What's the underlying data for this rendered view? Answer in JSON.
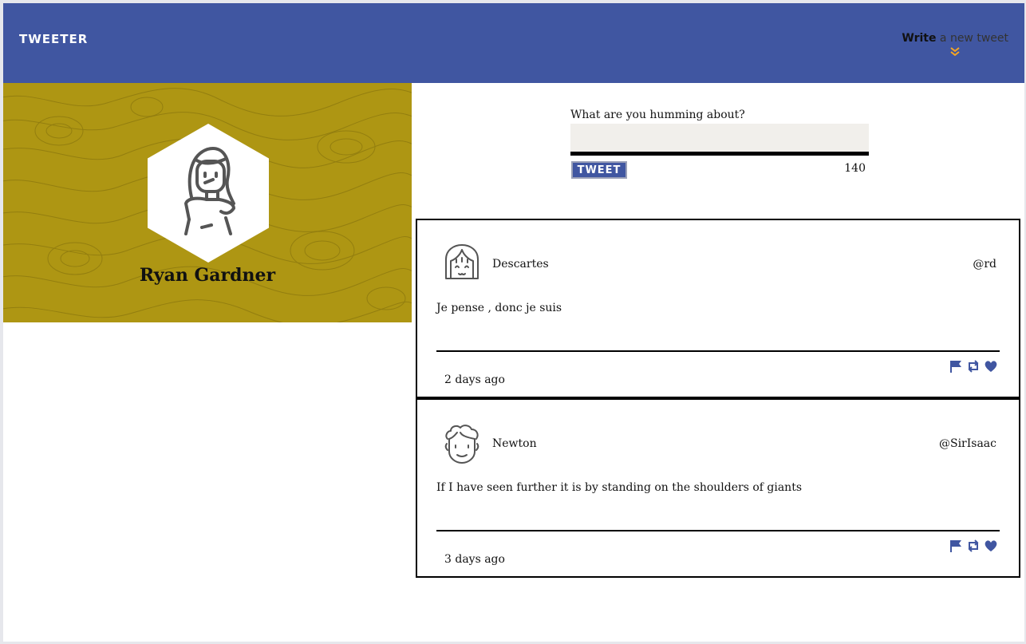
{
  "nav": {
    "brand": "TWEETER",
    "compose_bold": "Write",
    "compose_rest": " a new tweet",
    "compose_icon": "double-chevron-down-icon",
    "accent_color": "#f5a623"
  },
  "colors": {
    "nav_bg": "#4056a1",
    "profile_bg": "#ae9613",
    "composer_bg": "#f1efeb"
  },
  "profile": {
    "name": "Ryan Gardner",
    "avatar_icon": "woman-avatar-icon"
  },
  "composer": {
    "label": "What are you humming about?",
    "value": "",
    "placeholder": "",
    "button_label": "TWEET",
    "counter": "140"
  },
  "tweets": [
    {
      "name": "Descartes",
      "handle": "@rd",
      "avatar_icon": "girl-avatar-icon",
      "content": "Je pense , donc je suis",
      "time": "2 days ago",
      "action_icons": [
        "flag-icon",
        "retweet-icon",
        "heart-icon"
      ]
    },
    {
      "name": "Newton",
      "handle": "@SirIsaac",
      "avatar_icon": "curly-hair-avatar-icon",
      "content": "If I have seen further it is by standing on the shoulders of giants",
      "time": "3 days ago",
      "action_icons": [
        "flag-icon",
        "retweet-icon",
        "heart-icon"
      ]
    }
  ]
}
